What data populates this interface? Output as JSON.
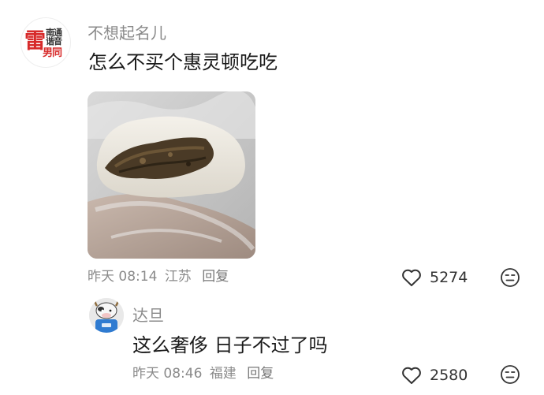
{
  "comment": {
    "avatar_text": {
      "big": "雷",
      "line1": "南通",
      "line2": "谐音",
      "line3": "男同"
    },
    "username": "不想起名儿",
    "content": "怎么不买个惠灵顿吃吃",
    "time": "昨天 08:14",
    "location": "江苏",
    "reply_label": "回复",
    "likes": "5274"
  },
  "reply": {
    "username": "达旦",
    "content": "这么奢侈 日子不过了吗",
    "time": "昨天 08:46",
    "location": "福建",
    "reply_label": "回复",
    "likes": "2580"
  },
  "icons": {
    "like": "heart-outline-icon",
    "dislike": "meh-face-icon"
  }
}
